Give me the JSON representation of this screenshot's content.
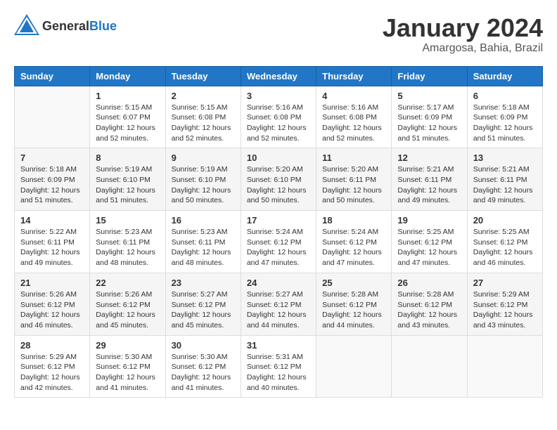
{
  "header": {
    "logo_general": "General",
    "logo_blue": "Blue",
    "month": "January 2024",
    "location": "Amargosa, Bahia, Brazil"
  },
  "weekdays": [
    "Sunday",
    "Monday",
    "Tuesday",
    "Wednesday",
    "Thursday",
    "Friday",
    "Saturday"
  ],
  "weeks": [
    [
      {
        "day": "",
        "sunrise": "",
        "sunset": "",
        "daylight": ""
      },
      {
        "day": "1",
        "sunrise": "Sunrise: 5:15 AM",
        "sunset": "Sunset: 6:07 PM",
        "daylight": "Daylight: 12 hours and 52 minutes."
      },
      {
        "day": "2",
        "sunrise": "Sunrise: 5:15 AM",
        "sunset": "Sunset: 6:08 PM",
        "daylight": "Daylight: 12 hours and 52 minutes."
      },
      {
        "day": "3",
        "sunrise": "Sunrise: 5:16 AM",
        "sunset": "Sunset: 6:08 PM",
        "daylight": "Daylight: 12 hours and 52 minutes."
      },
      {
        "day": "4",
        "sunrise": "Sunrise: 5:16 AM",
        "sunset": "Sunset: 6:08 PM",
        "daylight": "Daylight: 12 hours and 52 minutes."
      },
      {
        "day": "5",
        "sunrise": "Sunrise: 5:17 AM",
        "sunset": "Sunset: 6:09 PM",
        "daylight": "Daylight: 12 hours and 51 minutes."
      },
      {
        "day": "6",
        "sunrise": "Sunrise: 5:18 AM",
        "sunset": "Sunset: 6:09 PM",
        "daylight": "Daylight: 12 hours and 51 minutes."
      }
    ],
    [
      {
        "day": "7",
        "sunrise": "Sunrise: 5:18 AM",
        "sunset": "Sunset: 6:09 PM",
        "daylight": "Daylight: 12 hours and 51 minutes."
      },
      {
        "day": "8",
        "sunrise": "Sunrise: 5:19 AM",
        "sunset": "Sunset: 6:10 PM",
        "daylight": "Daylight: 12 hours and 51 minutes."
      },
      {
        "day": "9",
        "sunrise": "Sunrise: 5:19 AM",
        "sunset": "Sunset: 6:10 PM",
        "daylight": "Daylight: 12 hours and 50 minutes."
      },
      {
        "day": "10",
        "sunrise": "Sunrise: 5:20 AM",
        "sunset": "Sunset: 6:10 PM",
        "daylight": "Daylight: 12 hours and 50 minutes."
      },
      {
        "day": "11",
        "sunrise": "Sunrise: 5:20 AM",
        "sunset": "Sunset: 6:11 PM",
        "daylight": "Daylight: 12 hours and 50 minutes."
      },
      {
        "day": "12",
        "sunrise": "Sunrise: 5:21 AM",
        "sunset": "Sunset: 6:11 PM",
        "daylight": "Daylight: 12 hours and 49 minutes."
      },
      {
        "day": "13",
        "sunrise": "Sunrise: 5:21 AM",
        "sunset": "Sunset: 6:11 PM",
        "daylight": "Daylight: 12 hours and 49 minutes."
      }
    ],
    [
      {
        "day": "14",
        "sunrise": "Sunrise: 5:22 AM",
        "sunset": "Sunset: 6:11 PM",
        "daylight": "Daylight: 12 hours and 49 minutes."
      },
      {
        "day": "15",
        "sunrise": "Sunrise: 5:23 AM",
        "sunset": "Sunset: 6:11 PM",
        "daylight": "Daylight: 12 hours and 48 minutes."
      },
      {
        "day": "16",
        "sunrise": "Sunrise: 5:23 AM",
        "sunset": "Sunset: 6:11 PM",
        "daylight": "Daylight: 12 hours and 48 minutes."
      },
      {
        "day": "17",
        "sunrise": "Sunrise: 5:24 AM",
        "sunset": "Sunset: 6:12 PM",
        "daylight": "Daylight: 12 hours and 47 minutes."
      },
      {
        "day": "18",
        "sunrise": "Sunrise: 5:24 AM",
        "sunset": "Sunset: 6:12 PM",
        "daylight": "Daylight: 12 hours and 47 minutes."
      },
      {
        "day": "19",
        "sunrise": "Sunrise: 5:25 AM",
        "sunset": "Sunset: 6:12 PM",
        "daylight": "Daylight: 12 hours and 47 minutes."
      },
      {
        "day": "20",
        "sunrise": "Sunrise: 5:25 AM",
        "sunset": "Sunset: 6:12 PM",
        "daylight": "Daylight: 12 hours and 46 minutes."
      }
    ],
    [
      {
        "day": "21",
        "sunrise": "Sunrise: 5:26 AM",
        "sunset": "Sunset: 6:12 PM",
        "daylight": "Daylight: 12 hours and 46 minutes."
      },
      {
        "day": "22",
        "sunrise": "Sunrise: 5:26 AM",
        "sunset": "Sunset: 6:12 PM",
        "daylight": "Daylight: 12 hours and 45 minutes."
      },
      {
        "day": "23",
        "sunrise": "Sunrise: 5:27 AM",
        "sunset": "Sunset: 6:12 PM",
        "daylight": "Daylight: 12 hours and 45 minutes."
      },
      {
        "day": "24",
        "sunrise": "Sunrise: 5:27 AM",
        "sunset": "Sunset: 6:12 PM",
        "daylight": "Daylight: 12 hours and 44 minutes."
      },
      {
        "day": "25",
        "sunrise": "Sunrise: 5:28 AM",
        "sunset": "Sunset: 6:12 PM",
        "daylight": "Daylight: 12 hours and 44 minutes."
      },
      {
        "day": "26",
        "sunrise": "Sunrise: 5:28 AM",
        "sunset": "Sunset: 6:12 PM",
        "daylight": "Daylight: 12 hours and 43 minutes."
      },
      {
        "day": "27",
        "sunrise": "Sunrise: 5:29 AM",
        "sunset": "Sunset: 6:12 PM",
        "daylight": "Daylight: 12 hours and 43 minutes."
      }
    ],
    [
      {
        "day": "28",
        "sunrise": "Sunrise: 5:29 AM",
        "sunset": "Sunset: 6:12 PM",
        "daylight": "Daylight: 12 hours and 42 minutes."
      },
      {
        "day": "29",
        "sunrise": "Sunrise: 5:30 AM",
        "sunset": "Sunset: 6:12 PM",
        "daylight": "Daylight: 12 hours and 41 minutes."
      },
      {
        "day": "30",
        "sunrise": "Sunrise: 5:30 AM",
        "sunset": "Sunset: 6:12 PM",
        "daylight": "Daylight: 12 hours and 41 minutes."
      },
      {
        "day": "31",
        "sunrise": "Sunrise: 5:31 AM",
        "sunset": "Sunset: 6:12 PM",
        "daylight": "Daylight: 12 hours and 40 minutes."
      },
      {
        "day": "",
        "sunrise": "",
        "sunset": "",
        "daylight": ""
      },
      {
        "day": "",
        "sunrise": "",
        "sunset": "",
        "daylight": ""
      },
      {
        "day": "",
        "sunrise": "",
        "sunset": "",
        "daylight": ""
      }
    ]
  ]
}
